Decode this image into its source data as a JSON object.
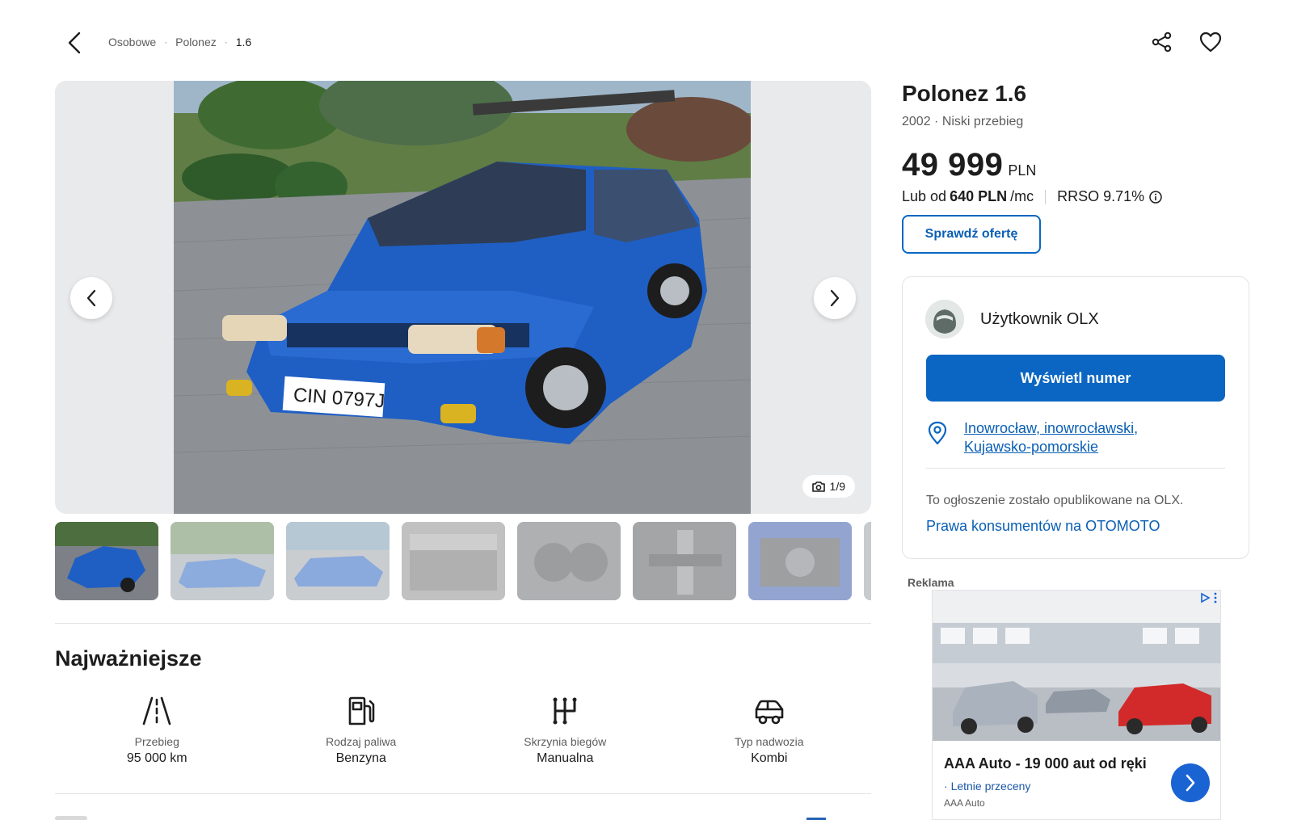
{
  "breadcrumb": {
    "items": [
      "Osobowe",
      "Polonez",
      "1.6"
    ],
    "separator": "·"
  },
  "icons": {
    "back": "chevron-left-icon",
    "share": "share-icon",
    "favorite": "heart-icon",
    "camera": "camera-icon",
    "info": "info-icon",
    "pin": "location-pin-icon"
  },
  "gallery": {
    "counter": "1/9",
    "thumbnail_count": 8
  },
  "listing": {
    "title": "Polonez 1.6",
    "subtitle": "2002 · Niski przebieg",
    "price": "49 999",
    "currency": "PLN",
    "finance_prefix": "Lub od",
    "finance_amount": "640 PLN",
    "finance_suffix": "/mc",
    "rrso": "RRSO 9.71%",
    "check_offer_label": "Sprawdź ofertę"
  },
  "seller": {
    "name": "Użytkownik OLX",
    "phone_button_label": "Wyświetl numer",
    "location": "Inowrocław, inowrocławski, Kujawsko-pomorskie",
    "published_note": "To ogłoszenie zostało opublikowane na OLX.",
    "rights_link": "Prawa konsumentów na OTOMOTO"
  },
  "highlights": {
    "title": "Najważniejsze",
    "items": [
      {
        "label": "Przebieg",
        "value": "95 000 km",
        "icon": "road-icon"
      },
      {
        "label": "Rodzaj paliwa",
        "value": "Benzyna",
        "icon": "fuel-pump-icon"
      },
      {
        "label": "Skrzynia biegów",
        "value": "Manualna",
        "icon": "gearbox-icon"
      },
      {
        "label": "Typ nadwozia",
        "value": "Kombi",
        "icon": "car-body-icon"
      }
    ]
  },
  "ad": {
    "label": "Reklama",
    "title": "AAA Auto - 19 000 aut od ręki",
    "subtitle": "Letnie przeceny",
    "brand": "AAA Auto"
  },
  "colors": {
    "accent": "#0a66c2",
    "car_blue": "#1f5fc4"
  }
}
